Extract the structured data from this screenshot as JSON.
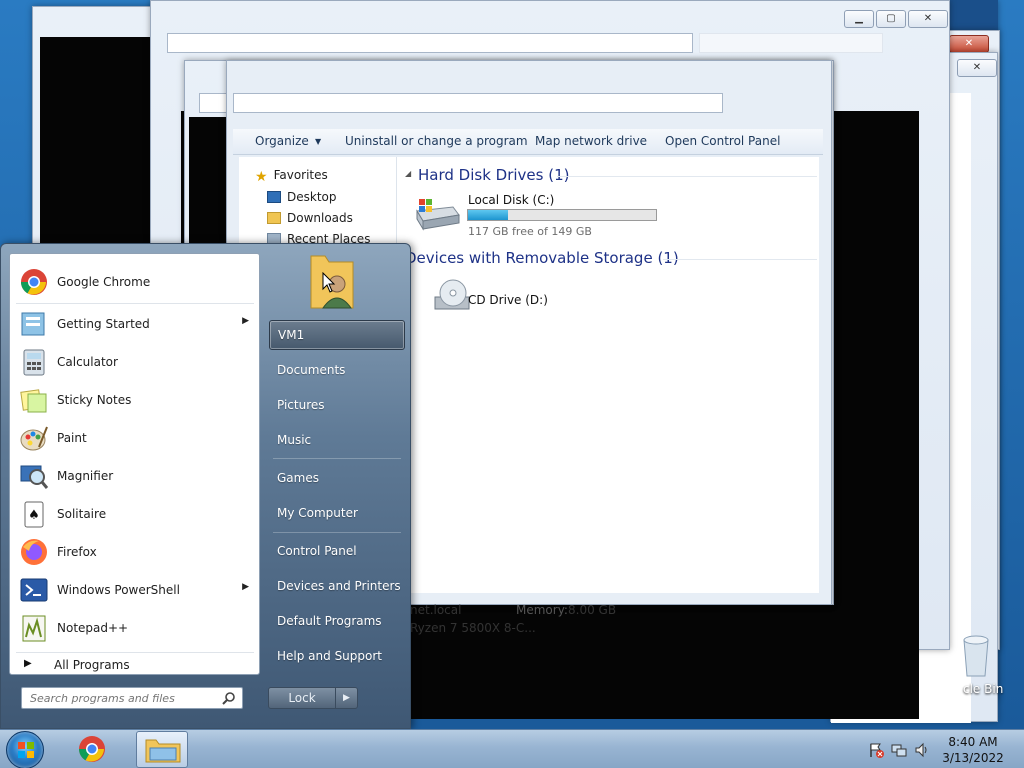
{
  "explorer": {
    "toolbar": [
      "Organize",
      "Uninstall or change a program",
      "Map network drive",
      "Open Control Panel"
    ],
    "nav": [
      "Favorites",
      "Desktop",
      "Downloads",
      "Recent Places"
    ],
    "groups": {
      "hard_disk": "Hard Disk Drives (1)",
      "removable": "Devices with Removable Storage (1)"
    },
    "drives": {
      "c_name": "Local Disk (C:)",
      "c_free": "117 GB free of 149 GB",
      "c_used_fraction": 0.215,
      "d_name": "CD Drive (D:)"
    },
    "details": {
      "domain": "net.local",
      "memory_label": "Memory:",
      "memory_value": "8.00 GB",
      "processor": "Ryzen 7 5800X 8-C..."
    }
  },
  "desktop": {
    "recycle_bin": "cle Bin"
  },
  "start_menu": {
    "programs": [
      {
        "label": "Google Chrome",
        "icon": "chrome-icon",
        "submenu": false
      },
      {
        "label": "Getting Started",
        "icon": "getting-started-icon",
        "submenu": true
      },
      {
        "label": "Calculator",
        "icon": "calculator-icon",
        "submenu": false
      },
      {
        "label": "Sticky Notes",
        "icon": "sticky-notes-icon",
        "submenu": false
      },
      {
        "label": "Paint",
        "icon": "paint-icon",
        "submenu": false
      },
      {
        "label": "Magnifier",
        "icon": "magnifier-icon",
        "submenu": false
      },
      {
        "label": "Solitaire",
        "icon": "solitaire-icon",
        "submenu": false
      },
      {
        "label": "Firefox",
        "icon": "firefox-icon",
        "submenu": false
      },
      {
        "label": "Windows PowerShell",
        "icon": "powershell-icon",
        "submenu": true
      },
      {
        "label": "Notepad++",
        "icon": "notepadpp-icon",
        "submenu": false
      }
    ],
    "all_programs": "All Programs",
    "search_placeholder": "Search programs and files",
    "right": {
      "user": "VM1",
      "documents": "Documents",
      "pictures": "Pictures",
      "music": "Music",
      "games": "Games",
      "my_computer": "My Computer",
      "control_panel": "Control Panel",
      "devices_printers": "Devices and Printers",
      "default_programs": "Default Programs",
      "help_support": "Help and Support"
    },
    "lock": "Lock"
  },
  "taskbar": {
    "time": "8:40 AM",
    "date": "3/13/2022"
  },
  "colors": {
    "accent": "#1e3287",
    "taskbar": "#98b4d2",
    "start_menu": "#5f7a96"
  }
}
